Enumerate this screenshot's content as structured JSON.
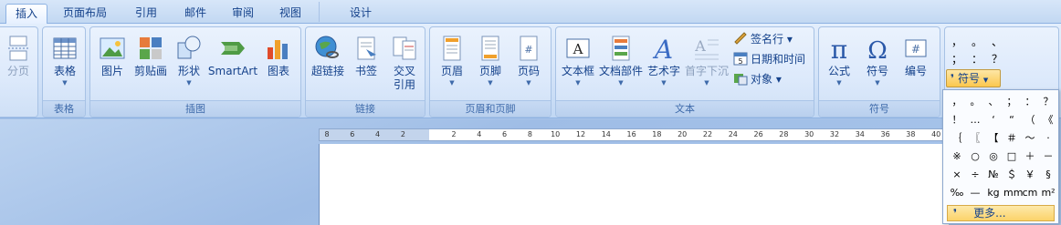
{
  "tabs": [
    {
      "label": "插入",
      "active": true
    },
    {
      "label": "页面布局"
    },
    {
      "label": "引用"
    },
    {
      "label": "邮件"
    },
    {
      "label": "审阅"
    },
    {
      "label": "视图"
    },
    {
      "label": "设计"
    }
  ],
  "groups": {
    "pages": {
      "button": "分页"
    },
    "table": {
      "label": "表格",
      "button": "表格"
    },
    "illustrations": {
      "label": "插图",
      "buttons": [
        "图片",
        "剪贴画",
        "形状",
        "SmartArt",
        "图表"
      ]
    },
    "links": {
      "label": "链接",
      "buttons": [
        "超链接",
        "书签",
        "交叉",
        "引用"
      ]
    },
    "header_footer": {
      "label": "页眉和页脚",
      "buttons": [
        "页眉",
        "页脚",
        "页码"
      ]
    },
    "text": {
      "label": "文本",
      "buttons": [
        "文本框",
        "文档部件",
        "艺术字",
        "首字下沉"
      ],
      "small": [
        "签名行 ▾",
        "日期和时间",
        "对象 ▾"
      ]
    },
    "symbols": {
      "label": "符号",
      "buttons": [
        "公式",
        "符号",
        "编号"
      ]
    }
  },
  "special_symbols": {
    "quick": [
      "，",
      "。",
      "、",
      "；",
      "：",
      "？"
    ],
    "dropdown_label": "符号",
    "grid": [
      [
        "，",
        "。",
        "、",
        "；",
        "：",
        "？"
      ],
      [
        "！",
        "…",
        "‘",
        "“",
        "（",
        "《"
      ],
      [
        "｛",
        "〖",
        "【",
        "＃",
        "～",
        "·"
      ],
      [
        "※",
        "○",
        "◎",
        "□",
        "＋",
        "－"
      ],
      [
        "×",
        "÷",
        "№",
        "＄",
        "￥",
        "§"
      ],
      [
        "‰",
        "—",
        "kg",
        "mm",
        "cm",
        "m²"
      ]
    ],
    "more": "更多..."
  },
  "ruler": {
    "ticks": [
      "8",
      "6",
      "4",
      "2",
      "",
      "2",
      "4",
      "6",
      "8",
      "10",
      "12",
      "14",
      "16",
      "18",
      "20",
      "22",
      "24",
      "26",
      "28",
      "30",
      "32",
      "34",
      "36",
      "38",
      "40"
    ]
  },
  "colors": {
    "accent": "#15428b",
    "ribbon": "#dce9fb",
    "highlight": "#fbc74e"
  }
}
